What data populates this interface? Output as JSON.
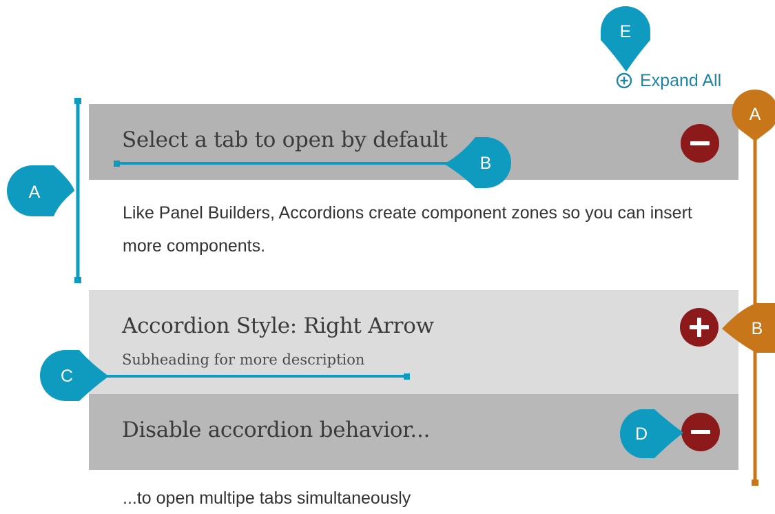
{
  "expand_all": {
    "label": "Expand All",
    "icon": "plus-circle-icon"
  },
  "accordion": {
    "panels": [
      {
        "title": "Select a tab to open by default",
        "subtitle": "",
        "state": "expanded",
        "toggle_icon": "minus-circle-icon",
        "body": "Like Panel Builders, Accordions create component zones so you can insert more components."
      },
      {
        "title": "Accordion Style: Right Arrow",
        "subtitle": "Subheading for more description",
        "state": "collapsed",
        "toggle_icon": "plus-circle-icon",
        "body": ""
      },
      {
        "title": "Disable accordion behavior...",
        "subtitle": "",
        "state": "expanded",
        "toggle_icon": "minus-circle-icon",
        "body": "...to open multipe tabs simultaneously"
      }
    ]
  },
  "callouts": {
    "blue_a": "A",
    "blue_b": "B",
    "blue_c": "C",
    "blue_d": "D",
    "blue_e": "E",
    "orange_a": "A",
    "orange_b": "B"
  },
  "colors": {
    "callout_blue": "#0e9bbf",
    "callout_orange": "#c8761a",
    "toggle": "#8c1a1a",
    "header_dark": "#b3b3b3",
    "header_light": "#dcdcdc",
    "link": "#1e86a3"
  }
}
